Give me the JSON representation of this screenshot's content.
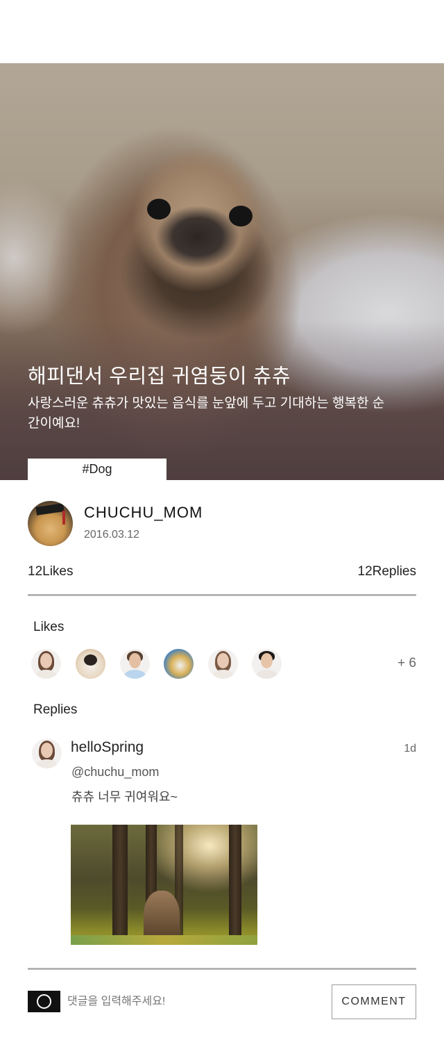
{
  "hero": {
    "title": "해피댄서 우리집 귀염둥이 츄츄",
    "description": "사랑스러운 츄츄가 맛있는 음식를 눈앞에 두고 기대하는 행복한 순간이예요!",
    "tag": "#Dog"
  },
  "post": {
    "author": "CHUCHU_MOM",
    "date": "2016.03.12",
    "likes_count": "12Likes",
    "replies_count": "12Replies"
  },
  "likes_section": {
    "label": "Likes",
    "avatars": [
      "woman-avatar",
      "dog-avatar",
      "man-avatar",
      "dog-avatar",
      "woman-avatar",
      "man-avatar"
    ],
    "more": "+ 6"
  },
  "replies_section": {
    "label": "Replies",
    "items": [
      {
        "user": "helloSpring",
        "time": "1d",
        "mention": "@chuchu_mom",
        "text": "츄츄 너무 귀여워요~"
      }
    ]
  },
  "comment_bar": {
    "placeholder": "댓글을 입력해주세요!",
    "button_label": "COMMENT"
  },
  "icons": {
    "input_icon": "circle-icon"
  }
}
